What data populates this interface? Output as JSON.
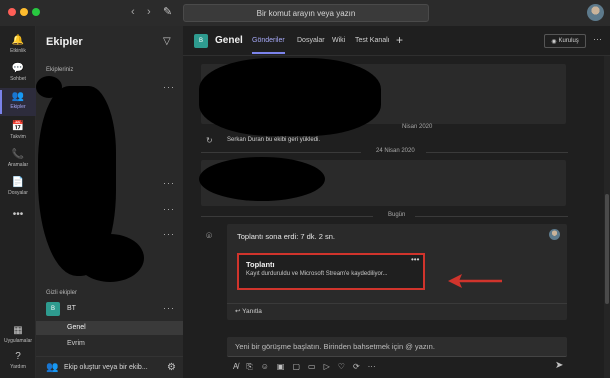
{
  "window": {
    "search_placeholder": "Bir komut arayın veya yazın"
  },
  "rail": {
    "items": [
      {
        "label": "Etkinlik",
        "icon": "bell-icon",
        "glyph": "🔔"
      },
      {
        "label": "Sohbet",
        "icon": "chat-icon",
        "glyph": "💬"
      },
      {
        "label": "Ekipler",
        "icon": "teams-icon",
        "glyph": "👥"
      },
      {
        "label": "Takvim",
        "icon": "calendar-icon",
        "glyph": "📅"
      },
      {
        "label": "Aramalar",
        "icon": "phone-icon",
        "glyph": "📞"
      },
      {
        "label": "Dosyalar",
        "icon": "files-icon",
        "glyph": "📄"
      },
      {
        "label": "",
        "icon": "more-icon",
        "glyph": "•••"
      }
    ],
    "bottom": [
      {
        "label": "Uygulamalar",
        "icon": "apps-icon",
        "glyph": "▦"
      },
      {
        "label": "Yardım",
        "icon": "help-icon",
        "glyph": "?"
      }
    ]
  },
  "panel": {
    "title": "Ekipler",
    "section_your_teams": "Ekipleriniz",
    "section_hidden": "Gizli ekipler",
    "team": {
      "badge": "B",
      "name": "BT"
    },
    "channels": [
      "Genel",
      "Evrim"
    ],
    "footer": "Ekip oluştur veya bir ekib..."
  },
  "channel": {
    "badge": "B",
    "title": "Genel",
    "tabs": [
      "Gönderiler",
      "Dosyalar",
      "Wiki",
      "Test Kanalı"
    ],
    "meeting_button": "Kuruluş",
    "dates": [
      "Nisan 2020",
      "24 Nisan 2020",
      "Bugün"
    ],
    "system_message": "Serkan Duran bu ekibi geri yükledi.",
    "meeting_ended": "Toplantı sona erdi: 7 dk. 2 sn.",
    "recording_title": "Toplantı",
    "recording_subtitle": "Kayıt durduruldu ve Microsoft Stream'e kaydediliyor...",
    "reply": "Yanıtla",
    "compose_placeholder": "Yeni bir görüşme başlatın. Birinden bahsetmek için @ yazın."
  },
  "colors": {
    "accent": "#7b83eb",
    "team_badge": "#2e9b8f",
    "highlight_box": "#d0342c"
  }
}
